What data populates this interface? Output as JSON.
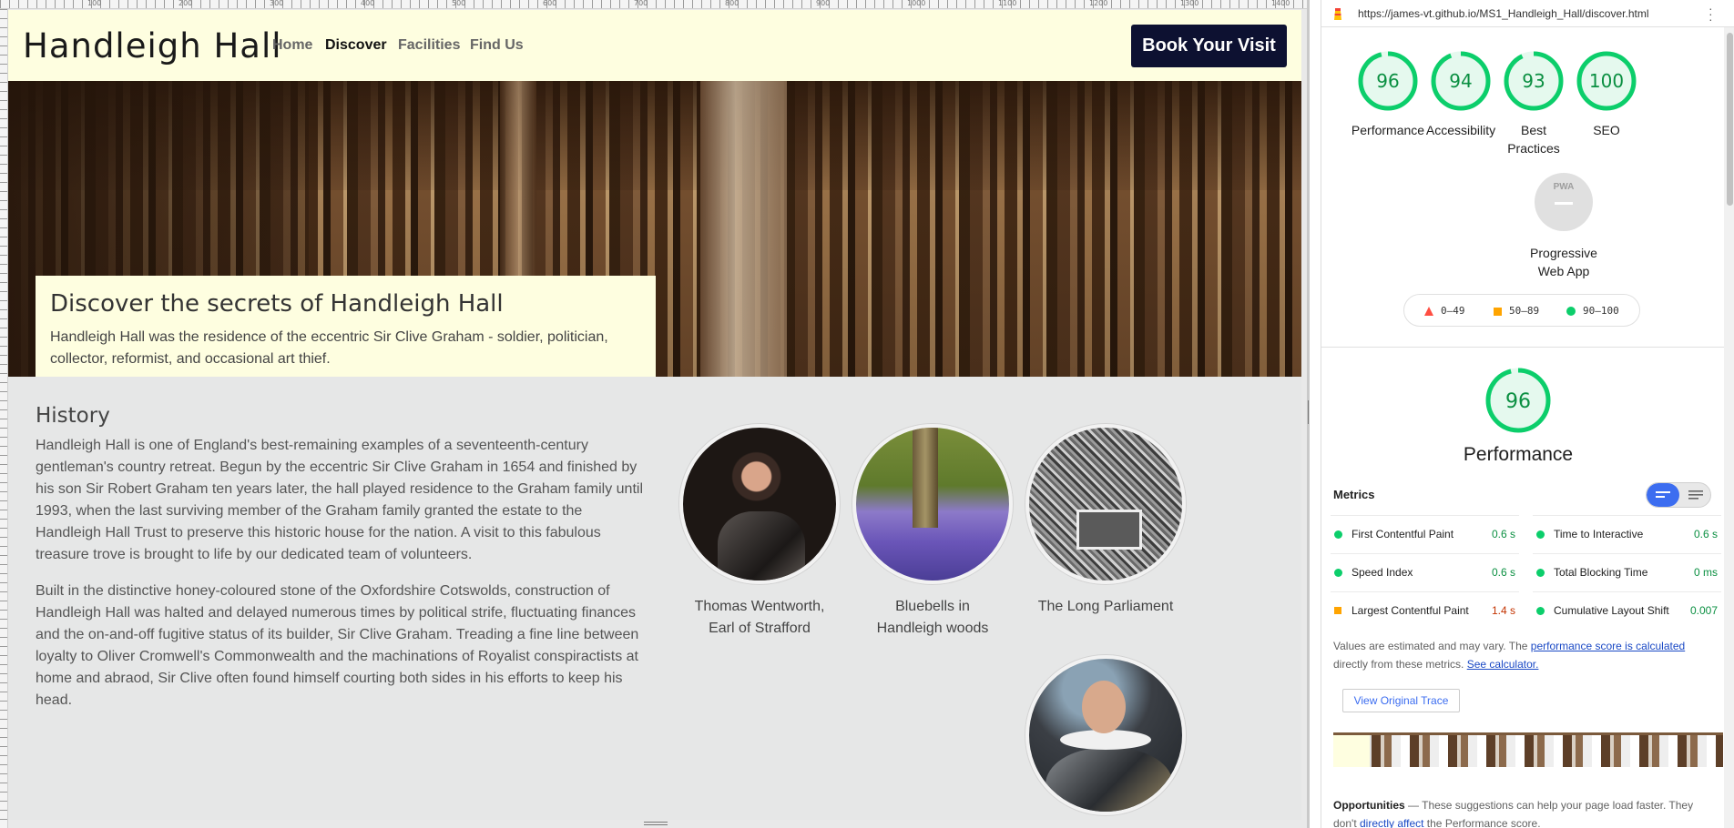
{
  "site": {
    "brand": "Handleigh Hall",
    "nav": [
      {
        "label": "Home"
      },
      {
        "label": "Discover"
      },
      {
        "label": "Facilities"
      },
      {
        "label": "Find Us"
      }
    ],
    "cta": "Book Your Visit"
  },
  "hero": {
    "title": "Discover the secrets of Handleigh Hall",
    "text": "Handleigh Hall was the residence of the eccentric Sir Clive Graham - soldier, politician, collector, reformist, and occasional art thief."
  },
  "history": {
    "title": "History",
    "paragraphs": [
      "Handleigh Hall is one of England's best-remaining examples of a seventeenth-century gentleman's country retreat. Begun by the eccentric Sir Clive Graham in 1654 and finished by his son Sir Robert Graham ten years later, the hall played residence to the Graham family until 1993, when the last surviving member of the Graham family granted the estate to the Handleigh Hall Trust to preserve this historic house for the nation. A visit to this fabulous treasure trove is brought to life by our dedicated team of volunteers.",
      "Built in the distinctive honey-coloured stone of the Oxfordshire Cotswolds, construction of Handleigh Hall was halted and delayed numerous times by political strife, fluctuating finances and the on-and-off fugitive status of its builder, Sir Clive Graham. Treading a fine line between loyalty to Oliver Cromwell's Commonwealth and the machinations of Royalist conspiractists at home and abraod, Sir Clive often found himself courting both sides in his efforts to keep his head."
    ],
    "images": [
      {
        "caption_line1": "Thomas Wentworth,",
        "caption_line2": "Earl of Strafford"
      },
      {
        "caption_line1": "Bluebells in",
        "caption_line2": "Handleigh woods"
      },
      {
        "caption_line1": "The Long Parliament",
        "caption_line2": ""
      },
      {
        "caption_line1": "",
        "caption_line2": ""
      }
    ]
  },
  "ruler": {
    "labels": [
      "100",
      "200",
      "300",
      "400",
      "500",
      "600",
      "700",
      "800",
      "900",
      "1000",
      "1100",
      "1200",
      "1300",
      "1400"
    ]
  },
  "lighthouse": {
    "url": "https://james-vt.github.io/MS1_Handleigh_Hall/discover.html",
    "scores": [
      {
        "label": "Performance",
        "value": 96
      },
      {
        "label": "Accessibility",
        "value": 94
      },
      {
        "label": "Best Practices",
        "value": 93
      },
      {
        "label": "SEO",
        "value": 100
      }
    ],
    "pwa": {
      "badge": "PWA",
      "label_line1": "Progressive",
      "label_line2": "Web App"
    },
    "legend": [
      {
        "range": "0–49",
        "color": "#ff4e42",
        "shape": "triangle"
      },
      {
        "range": "50–89",
        "color": "#ffa400",
        "shape": "square"
      },
      {
        "range": "90–100",
        "color": "#0cce6b",
        "shape": "circle"
      }
    ],
    "performance": {
      "score": 96,
      "title": "Performance",
      "metrics_title": "Metrics",
      "metrics": [
        {
          "name": "First Contentful Paint",
          "value": "0.6 s",
          "status": "pass"
        },
        {
          "name": "Time to Interactive",
          "value": "0.6 s",
          "status": "pass"
        },
        {
          "name": "Speed Index",
          "value": "0.6 s",
          "status": "pass"
        },
        {
          "name": "Total Blocking Time",
          "value": "0 ms",
          "status": "pass"
        },
        {
          "name": "Largest Contentful Paint",
          "value": "1.4 s",
          "status": "average"
        },
        {
          "name": "Cumulative Layout Shift",
          "value": "0.007",
          "status": "pass"
        }
      ],
      "note_prefix": "Values are estimated and may vary. The ",
      "note_link1": "performance score is calculated",
      "note_middle": " directly from these metrics. ",
      "note_link2": "See calculator.",
      "trace_button": "View Original Trace",
      "opps_title": "Opportunities",
      "opps_text_prefix": " — These suggestions can help your page load faster. They don't ",
      "opps_link": "directly affect",
      "opps_text_suffix": " the Performance score."
    },
    "colors": {
      "pass": "#0cce6b",
      "average": "#ffa400",
      "fail": "#ff4e42"
    }
  }
}
